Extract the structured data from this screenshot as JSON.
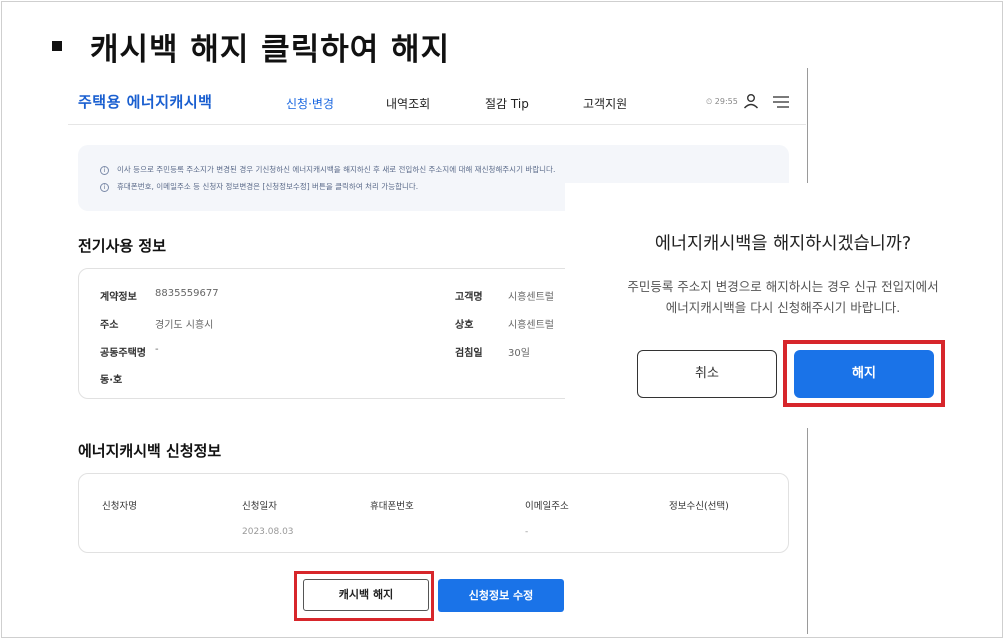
{
  "slide": {
    "title": "캐시백 해지 클릭하여 해지"
  },
  "header": {
    "logo": "주택용 에너지캐시백",
    "nav": [
      "신청·변경",
      "내역조회",
      "절감 Tip",
      "고객지원"
    ],
    "time": "⏲ 29:55",
    "icons": [
      "user-icon",
      "menu-icon"
    ]
  },
  "notice": {
    "lines": [
      "이사 등으로 주민등록 주소지가 변경된 경우 기신청하신 에너지캐시백을 해지하신 후 새로 전입하신 주소지에 대해 재신청해주시기 바랍니다.",
      "휴대폰번호, 이메일주소 등 신청자 정보변경은 [신청정보수정] 버튼을 클릭하여 처리 가능합니다."
    ]
  },
  "electricity": {
    "title": "전기사용 정보",
    "contract_label": "계약정보",
    "contract_value": "8835559677",
    "address_label": "주소",
    "address_value": "경기도 시흥시",
    "complex_label": "공동주택명",
    "complex_value": "-",
    "unit_label": "동·호",
    "customer_label": "고객명",
    "customer_value": "시흥센트럴",
    "company_label": "상호",
    "company_value": "시흥센트럴",
    "reading_label": "검침일",
    "reading_value": "30일"
  },
  "application": {
    "title": "에너지캐시백 신청정보",
    "headers": [
      "신청자명",
      "신청일자",
      "휴대폰번호",
      "이메일주소",
      "정보수신(선택)"
    ],
    "values": [
      "",
      "2023.08.03",
      "",
      "-",
      ""
    ]
  },
  "buttons": {
    "cancel_cashback": "캐시백 해지",
    "edit_info": "신청정보 수정"
  },
  "modal": {
    "title": "에너지캐시백을 해지하시겠습니까?",
    "message_line1": "주민등록 주소지 변경으로 해지하시는 경우 신규 전입지에서",
    "message_line2": "에너지캐시백을 다시 신청해주시기 바랍니다.",
    "cancel": "취소",
    "confirm": "해지"
  },
  "colors": {
    "accent": "#1a73e8",
    "highlight": "#d7262b"
  }
}
